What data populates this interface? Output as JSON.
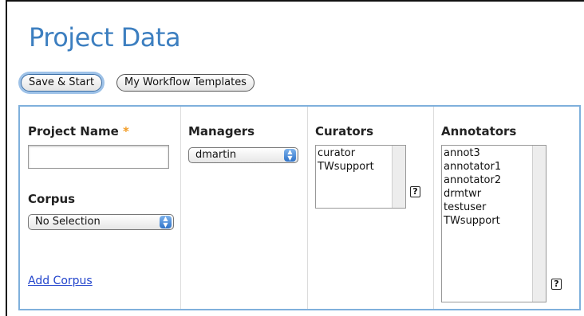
{
  "page": {
    "title": "Project Data"
  },
  "toolbar": {
    "save_start_label": "Save & Start",
    "workflow_templates_label": "My Workflow Templates"
  },
  "project": {
    "name_label": "Project Name",
    "required_mark": "*",
    "name_value": "",
    "corpus_label": "Corpus",
    "corpus_selected": "No Selection",
    "add_corpus_label": "Add Corpus"
  },
  "managers": {
    "label": "Managers",
    "selected": "dmartin"
  },
  "curators": {
    "label": "Curators",
    "items": [
      "curator",
      "TWsupport"
    ],
    "help_label": "?"
  },
  "annotators": {
    "label": "Annotators",
    "items": [
      "annot3",
      "annotator1",
      "annotator2",
      "drmtwr",
      "testuser",
      "TWsupport"
    ],
    "help_label": "?"
  },
  "colors": {
    "title": "#3d7fc0",
    "panel_border": "#7fb0dc",
    "required": "#f29b24",
    "link": "#2244cc"
  }
}
